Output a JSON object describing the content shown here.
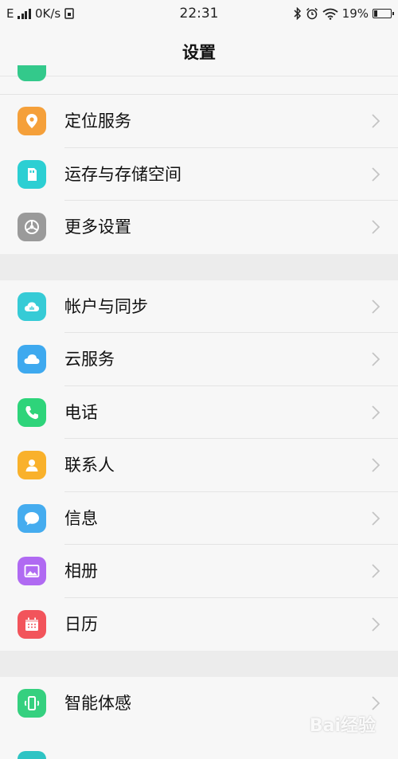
{
  "status_bar": {
    "network": "E",
    "speed": "0K/s",
    "time": "22:31",
    "battery_percent_text": "19%",
    "battery_level": 0.19,
    "icons": [
      "signal-icon",
      "sim-icon",
      "bluetooth-icon",
      "alarm-icon",
      "wifi-icon",
      "battery-icon"
    ]
  },
  "header": {
    "title": "设置"
  },
  "settings": {
    "group1": [
      {
        "label": "定位服务",
        "icon": "location-icon",
        "color": "#f5a03a"
      },
      {
        "label": "运存与存储空间",
        "icon": "storage-icon",
        "color": "#2ccfd3"
      },
      {
        "label": "更多设置",
        "icon": "gear-icon",
        "color": "#9a9a9a"
      }
    ],
    "group2": [
      {
        "label": "帐户与同步",
        "icon": "account-sync-icon",
        "color": "#36cbd6"
      },
      {
        "label": "云服务",
        "icon": "cloud-icon",
        "color": "#3ea9ef"
      },
      {
        "label": "电话",
        "icon": "phone-icon",
        "color": "#2ed47a"
      },
      {
        "label": "联系人",
        "icon": "contact-icon",
        "color": "#f9b12b"
      },
      {
        "label": "信息",
        "icon": "message-icon",
        "color": "#45acef"
      },
      {
        "label": "相册",
        "icon": "album-icon",
        "color": "#b06af2"
      },
      {
        "label": "日历",
        "icon": "calendar-icon",
        "color": "#f2545b"
      }
    ],
    "group3": [
      {
        "label": "智能体感",
        "icon": "smart-motion-icon",
        "color": "#35d07f"
      }
    ]
  },
  "watermark": "Bai经验"
}
